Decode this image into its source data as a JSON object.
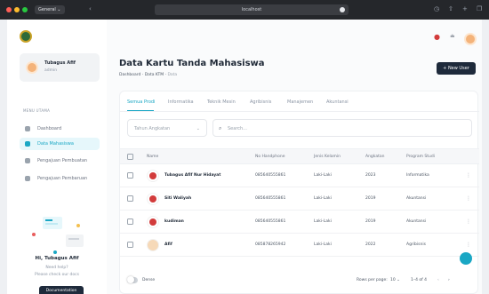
{
  "browser": {
    "tab_group": "General",
    "url": "localhost"
  },
  "sidebar": {
    "user": {
      "name": "Tubagus Afif",
      "role": "admin"
    },
    "menu_heading": "MENU UTAMA",
    "items": [
      {
        "label": "Dashboard",
        "icon": "grid-icon"
      },
      {
        "label": "Data Mahasiswa",
        "icon": "user-icon",
        "active": true
      },
      {
        "label": "Pengajuan Pembuatan",
        "icon": "document-icon"
      },
      {
        "label": "Pengajuan Pembaruan",
        "icon": "document-icon"
      }
    ],
    "greeting": "Hi, Tubagus Afif",
    "help_line1": "Need help?",
    "help_line2": "Please check our docs",
    "docs_button": "Documentation"
  },
  "header": {
    "title": "Data Kartu Tanda Mahasiswa",
    "breadcrumb": [
      "Dashboard",
      "Data KTM",
      "Data"
    ],
    "new_button": "New User"
  },
  "tabs": [
    "Semua Prodi",
    "Informatika",
    "Teknik Mesin",
    "Agribisnis",
    "Manajemen",
    "Akuntansi"
  ],
  "filters": {
    "year_placeholder": "Tahun Angkatan",
    "search_placeholder": "Search..."
  },
  "table": {
    "columns": [
      "Name",
      "No Handphone",
      "Jenis Kelamin",
      "Angkatan",
      "Program Studi"
    ],
    "rows": [
      {
        "name": "Tubagus Afif Nur Hidayat",
        "phone": "085640555861",
        "gender": "Laki-Laki",
        "year": "2023",
        "program": "Informatika"
      },
      {
        "name": "Siti Waliyah",
        "phone": "085640555861",
        "gender": "Laki-Laki",
        "year": "2019",
        "program": "Akuntansi"
      },
      {
        "name": "kudiman",
        "phone": "085640555861",
        "gender": "Laki-Laki",
        "year": "2019",
        "program": "Akuntansi"
      },
      {
        "name": "Afif",
        "phone": "085878265942",
        "gender": "Laki-Laki",
        "year": "2022",
        "program": "Agribisnis"
      }
    ]
  },
  "footer": {
    "dense_label": "Dense",
    "rows_per_page_label": "Rows per page:",
    "rows_per_page": "10",
    "range": "1–4 of 4"
  },
  "colors": {
    "accent": "#1aa7c4",
    "dark_button": "#1e2a3b"
  }
}
